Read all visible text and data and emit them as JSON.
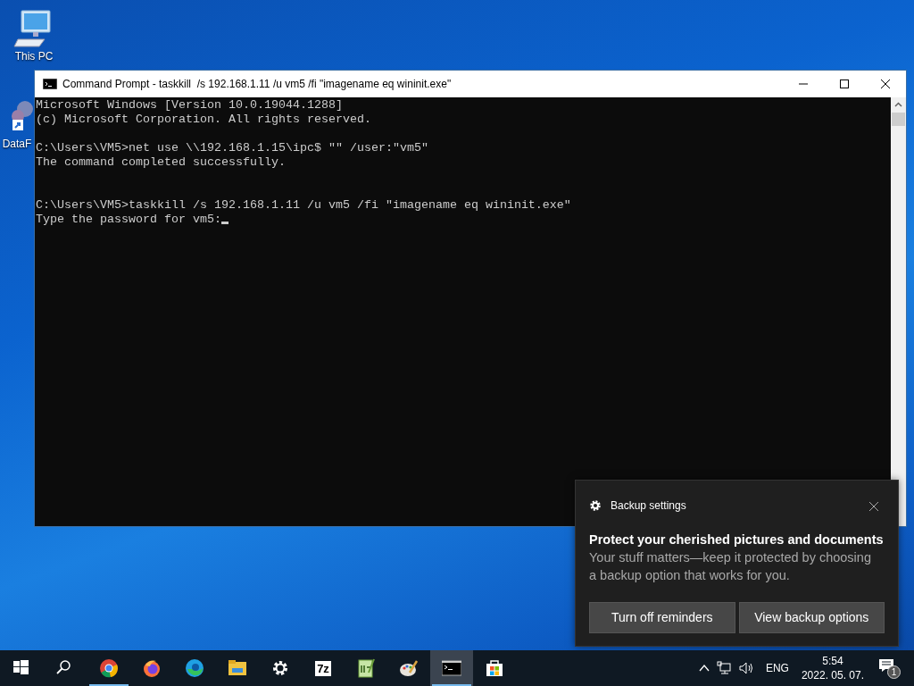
{
  "desktop_icons": [
    {
      "kind": "computer",
      "label": "This PC"
    },
    {
      "kind": "shortcut",
      "label": "DataF"
    }
  ],
  "console": {
    "title": "Command Prompt - taskkill  /s 192.168.1.11 /u vm5 /fi \"imagename eq wininit.exe\"",
    "lines": [
      {
        "kind": "text",
        "text": "Microsoft Windows [Version 10.0.19044.1288]"
      },
      {
        "kind": "text",
        "text": "(c) Microsoft Corporation. All rights reserved."
      },
      {
        "kind": "blank"
      },
      {
        "kind": "text",
        "text": "C:\\Users\\VM5>net use \\\\192.168.1.15\\ipc$ \"\" /user:\"vm5\""
      },
      {
        "kind": "text",
        "text": "The command completed successfully."
      },
      {
        "kind": "blank"
      },
      {
        "kind": "blank"
      },
      {
        "kind": "text",
        "text": "C:\\Users\\VM5>taskkill /s 192.168.1.11 /u vm5 /fi \"imagename eq wininit.exe\""
      },
      {
        "kind": "prompt",
        "text": "Type the password for vm5:"
      }
    ]
  },
  "toast": {
    "app": "Backup settings",
    "title": "Protect your cherished pictures and documents",
    "body": "Your stuff matters—keep it protected by choosing a backup option that works for you.",
    "buttons": [
      "Turn off reminders",
      "View backup options"
    ]
  },
  "taskbar": {
    "apps": [
      {
        "kind": "start",
        "running": false,
        "selected": false
      },
      {
        "kind": "search",
        "running": false,
        "selected": false
      },
      {
        "kind": "chrome",
        "running": true,
        "selected": false
      },
      {
        "kind": "firefox",
        "running": false,
        "selected": false
      },
      {
        "kind": "edge",
        "running": false,
        "selected": false
      },
      {
        "kind": "folder",
        "running": false,
        "selected": false
      },
      {
        "kind": "gear",
        "running": false,
        "selected": false
      },
      {
        "kind": "sevenzip",
        "label": "7z",
        "running": false,
        "selected": false
      },
      {
        "kind": "notepad",
        "running": false,
        "selected": false
      },
      {
        "kind": "palette",
        "running": false,
        "selected": false
      },
      {
        "kind": "console",
        "running": true,
        "selected": true
      },
      {
        "kind": "store",
        "running": false,
        "selected": false
      }
    ],
    "language": "ENG",
    "time": "5:54",
    "date": "2022. 05. 07.",
    "notifications": "1"
  }
}
